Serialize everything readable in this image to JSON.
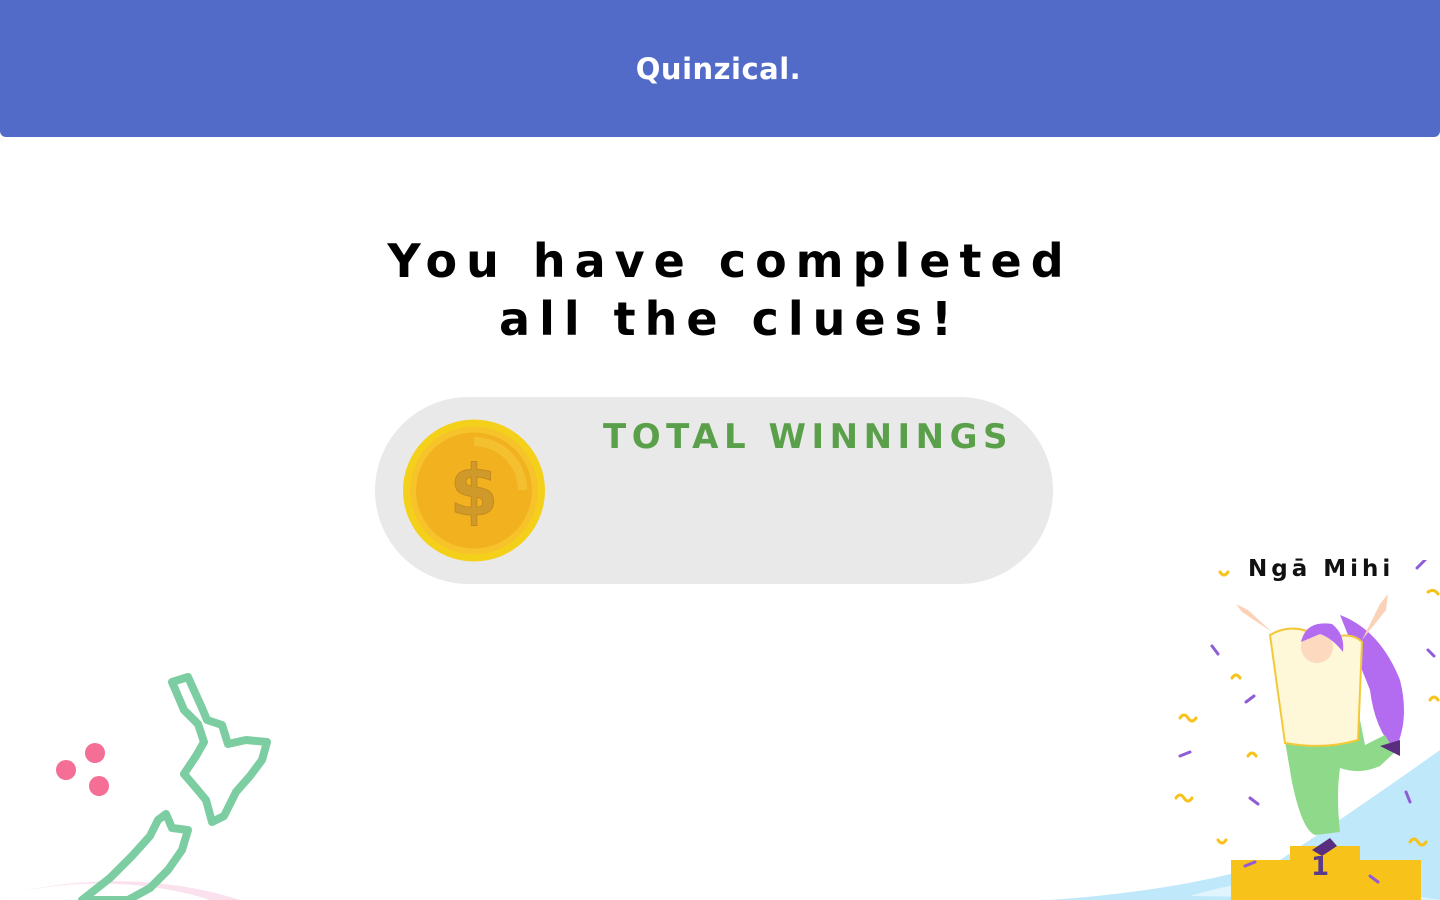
{
  "header": {
    "app_title": "Quinzical."
  },
  "completion": {
    "line1": "You have completed",
    "line2": "all the clues!"
  },
  "winnings": {
    "label": "TOTAL WINNINGS",
    "value": "",
    "icon": "coin-dollar-icon"
  },
  "celebration": {
    "message": "Ngā Mihi",
    "podium_place": "1"
  },
  "colors": {
    "header_bg": "#526bc9",
    "winnings_label": "#5aa04a",
    "card_bg": "#e9e9e9",
    "coin_gold": "#f3c52a"
  }
}
